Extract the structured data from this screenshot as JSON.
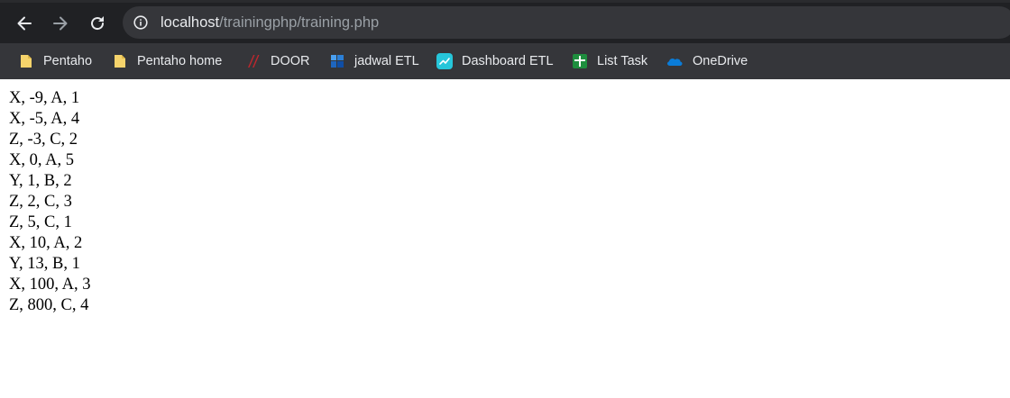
{
  "browser": {
    "url_host": "localhost",
    "url_path": "/trainingphp/training.php"
  },
  "bookmarks": [
    {
      "label": "Pentaho",
      "icon": "folder-icon"
    },
    {
      "label": "Pentaho home",
      "icon": "folder-icon"
    },
    {
      "label": "DOOR",
      "icon": "door-logo-icon"
    },
    {
      "label": "jadwal ETL",
      "icon": "planner-icon"
    },
    {
      "label": "Dashboard ETL",
      "icon": "dashboard-icon"
    },
    {
      "label": "List Task",
      "icon": "sheets-icon"
    },
    {
      "label": "OneDrive",
      "icon": "cloud-icon"
    }
  ],
  "page": {
    "lines": [
      "X, -9, A, 1",
      "X, -5, A, 4",
      "Z, -3, C, 2",
      "X, 0, A, 5",
      "Y, 1, B, 2",
      "Z, 2, C, 3",
      "Z, 5, C, 1",
      "X, 10, A, 2",
      "Y, 13, B, 1",
      "X, 100, A, 3",
      "Z, 800, C, 4"
    ]
  },
  "colors": {
    "toolbar_bg": "#202124",
    "omnibox_bg": "#35363a",
    "bookmarks_bg": "#35363a",
    "folder": "#f5d36b",
    "sheets": "#1e8e3e",
    "dashboard": "#26c6da",
    "onedrive": "#0a7cd8",
    "door": "#c0272d"
  }
}
